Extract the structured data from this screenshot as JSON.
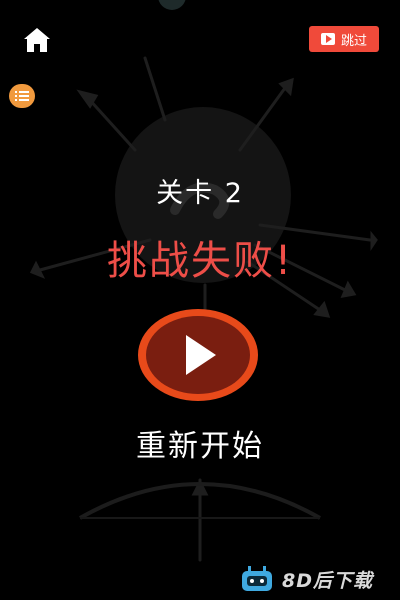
{
  "header": {
    "home_icon": "home-icon",
    "skip_button": {
      "icon": "video-play-icon",
      "label": "跳过",
      "color": "#f04a3a"
    },
    "menu_button": {
      "icon": "list-icon",
      "color": "#f19a3e"
    }
  },
  "result": {
    "level_label": "关卡 2",
    "fail_message": "挑战失败!",
    "fail_color": "#ee4e48"
  },
  "replay": {
    "icon": "play-icon",
    "label": "重新开始",
    "accent": "#e84a1a"
  },
  "watermark": {
    "icon": "robot-mascot-icon",
    "text": "8D后下载"
  }
}
